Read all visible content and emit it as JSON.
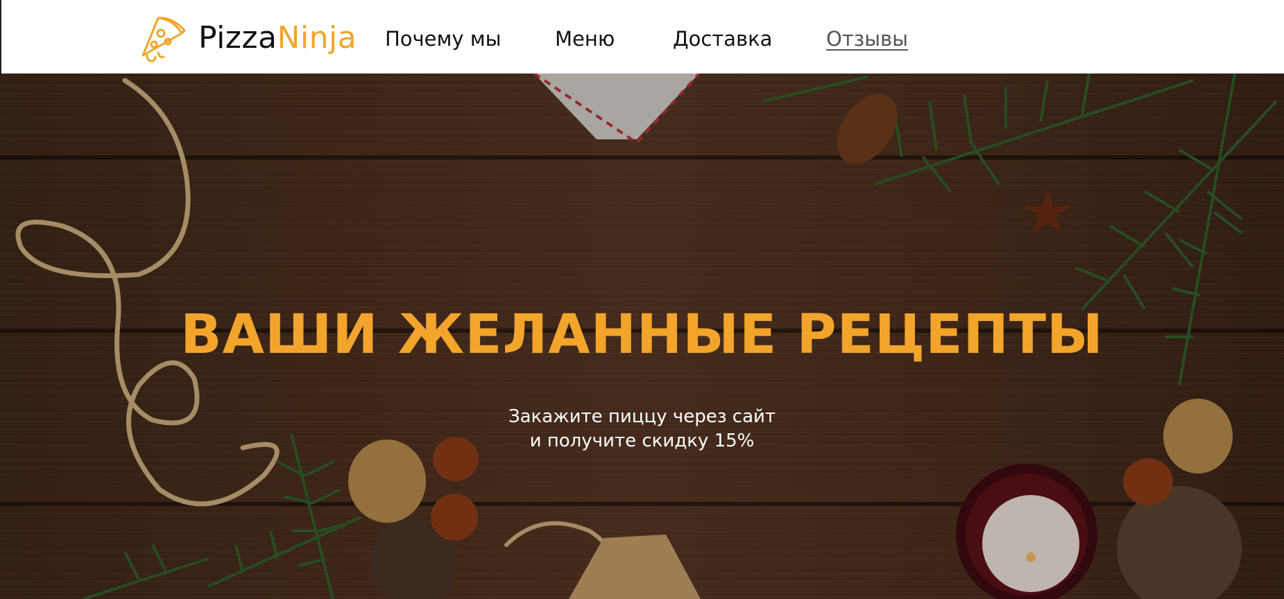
{
  "brand": {
    "name_part1": "Pizza",
    "name_part2": "Ninja",
    "icon": "pizza-slice-icon",
    "accent_color": "#f2a42b"
  },
  "nav": {
    "items": [
      {
        "label": "Почему мы",
        "active": false
      },
      {
        "label": "Меню",
        "active": false
      },
      {
        "label": "Доставка",
        "active": false
      },
      {
        "label": "Отзывы",
        "active": true
      }
    ]
  },
  "hero": {
    "title": "ВАШИ ЖЕЛАННЫЕ РЕЦЕПТЫ",
    "subtitle_line1": "Закажите пиццу через сайт",
    "subtitle_line2": "и получите скидку 15%",
    "background": "wooden-table-with-christmas-decorations"
  }
}
